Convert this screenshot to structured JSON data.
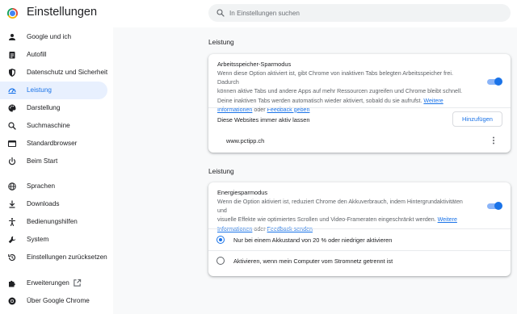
{
  "app": {
    "title": "Einstellungen"
  },
  "search": {
    "placeholder": "In Einstellungen suchen",
    "value": ""
  },
  "sidebar": {
    "items": [
      {
        "label": "Google und ich",
        "icon": "person-icon"
      },
      {
        "label": "Autofill",
        "icon": "clipboard-icon"
      },
      {
        "label": "Datenschutz und Sicherheit",
        "icon": "shield-icon"
      },
      {
        "label": "Leistung",
        "icon": "speedometer-icon",
        "active": true
      },
      {
        "label": "Darstellung",
        "icon": "palette-icon"
      },
      {
        "label": "Suchmaschine",
        "icon": "search-icon"
      },
      {
        "label": "Standardbrowser",
        "icon": "browser-icon"
      },
      {
        "label": "Beim Start",
        "icon": "power-icon"
      },
      {
        "label": "Sprachen",
        "icon": "globe-icon"
      },
      {
        "label": "Downloads",
        "icon": "download-icon"
      },
      {
        "label": "Bedienungshilfen",
        "icon": "accessibility-icon"
      },
      {
        "label": "System",
        "icon": "wrench-icon"
      },
      {
        "label": "Einstellungen zurücksetzen",
        "icon": "reset-icon"
      },
      {
        "label": "Erweiterungen",
        "icon": "puzzle-icon"
      },
      {
        "label": "Über Google Chrome",
        "icon": "chrome-icon"
      }
    ],
    "external_link_icon": "external-link-icon"
  },
  "memory_section": {
    "title": "Leistung",
    "heading": "Arbeitsspeicher-Sparmodus",
    "desc_line1": "Wenn diese Option aktiviert ist, gibt Chrome von inaktiven Tabs belegten Arbeitsspeicher frei. Dadurch",
    "desc_line2": "können aktive Tabs und andere Apps auf mehr Ressourcen zugreifen und Chrome bleibt schnell.",
    "desc_line3": "Deine inaktiven Tabs werden automatisch wieder aktiviert, sobald du sie aufrufst.",
    "link_more": "Weitere Informationen",
    "link_more_part1": "Weitere",
    "link_more_part2": "Informationen",
    "connector": "oder",
    "link_feedback": "Feedback geben",
    "toggle_on": true,
    "always_active_label": "Diese Websites immer aktiv lassen",
    "add_button": "Hinzufügen",
    "sites": [
      "www.pctipp.ch"
    ]
  },
  "energy_section": {
    "title": "Leistung",
    "heading": "Energiesparmodus",
    "desc_line1": "Wenn die Option aktiviert ist, reduziert Chrome den Akkuverbrauch, indem Hintergrundaktivitäten und",
    "desc_line2": "visuelle Effekte wie optimiertes Scrollen und Video-Frameraten eingeschränkt werden.",
    "link_more_part1": "Weitere",
    "link_more_part2": "Informationen",
    "connector": "oder",
    "link_feedback": "Feedback senden",
    "toggle_on": true,
    "options": [
      {
        "label": "Nur bei einem Akkustand von 20 % oder niedriger aktivieren",
        "checked": true
      },
      {
        "label": "Aktivieren, wenn mein Computer vom Stromnetz getrennt ist",
        "checked": false
      }
    ]
  },
  "colors": {
    "accent": "#1a73e8",
    "active_bg": "#e8f0fe",
    "background": "#f8f9fa"
  }
}
